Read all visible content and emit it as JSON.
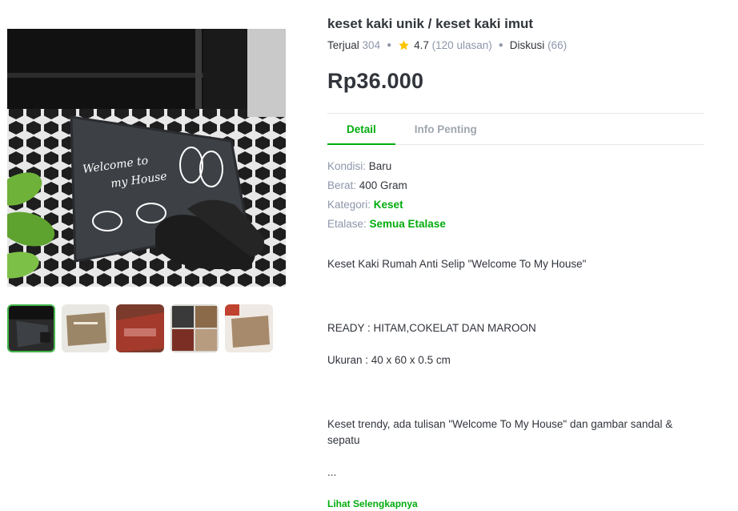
{
  "product": {
    "title": "keset kaki unik / keset kaki imut",
    "sold_label": "Terjual",
    "sold_count": "304",
    "rating": "4.7",
    "reviews": "(120 ulasan)",
    "discussion_label": "Diskusi",
    "discussion_count": "(66)",
    "price": "Rp36.000"
  },
  "tabs": [
    "Detail",
    "Info Penting"
  ],
  "specs": {
    "condition_label": "Kondisi: ",
    "condition_value": "Baru",
    "weight_label": "Berat: ",
    "weight_value": "400 Gram",
    "category_label": "Kategori: ",
    "category_value": "Keset",
    "showcase_label": "Etalase: ",
    "showcase_value": "Semua Etalase"
  },
  "description": {
    "line1": "Keset Kaki Rumah Anti Selip \"Welcome To My House\"",
    "line2": "READY : HITAM,COKELAT DAN MAROON",
    "line3": "Ukuran : 40 x 60 x 0.5 cm",
    "line4": "Keset trendy, ada tulisan \"Welcome To My House\" dan gambar sandal & sepatu",
    "ellipsis": "...",
    "more_link": "Lihat Selengkapnya"
  },
  "image": {
    "mat_text_1": "Welcome to",
    "mat_text_2": "my House"
  },
  "colors": {
    "accent": "#03ac0e",
    "thumb_border": "#42b549",
    "star": "#ffc400"
  },
  "icons": [
    "star-icon"
  ]
}
